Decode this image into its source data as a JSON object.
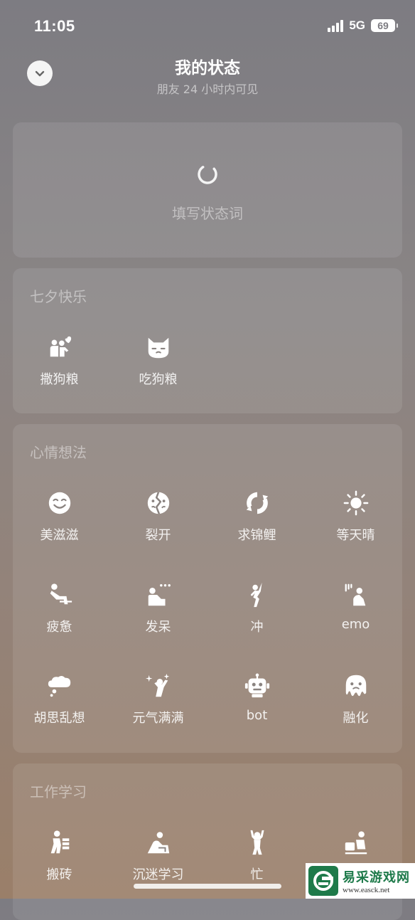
{
  "status_bar": {
    "time": "11:05",
    "network": "5G",
    "battery": "69"
  },
  "header": {
    "title": "我的状态",
    "subtitle": "朋友 24 小时内可见",
    "collapse_icon": "chevron-down-icon"
  },
  "status_input": {
    "placeholder": "填写状态词"
  },
  "sections": [
    {
      "title": "七夕快乐",
      "items": [
        {
          "label": "撒狗粮",
          "icon": "couple-heart-icon"
        },
        {
          "label": "吃狗粮",
          "icon": "cat-face-icon"
        }
      ]
    },
    {
      "title": "心情想法",
      "items": [
        {
          "label": "美滋滋",
          "icon": "smile-face-icon"
        },
        {
          "label": "裂开",
          "icon": "cracked-face-icon"
        },
        {
          "label": "求锦鲤",
          "icon": "koi-icon"
        },
        {
          "label": "等天晴",
          "icon": "sun-icon"
        },
        {
          "label": "疲惫",
          "icon": "tired-person-icon"
        },
        {
          "label": "发呆",
          "icon": "daze-person-icon"
        },
        {
          "label": "冲",
          "icon": "charge-person-icon"
        },
        {
          "label": "emo",
          "icon": "emo-person-icon"
        },
        {
          "label": "胡思乱想",
          "icon": "thought-cloud-icon"
        },
        {
          "label": "元气满满",
          "icon": "energetic-person-icon"
        },
        {
          "label": "bot",
          "icon": "robot-icon"
        },
        {
          "label": "融化",
          "icon": "melting-face-icon"
        }
      ]
    },
    {
      "title": "工作学习",
      "items": [
        {
          "label": "搬砖",
          "icon": "carry-bricks-icon"
        },
        {
          "label": "沉迷学习",
          "icon": "study-person-icon"
        },
        {
          "label": "忙",
          "icon": "busy-person-icon"
        },
        {
          "label": "",
          "icon": "desk-person-icon"
        }
      ]
    }
  ],
  "watermark": {
    "text": "易采游戏网",
    "url": "www.easck.net"
  }
}
